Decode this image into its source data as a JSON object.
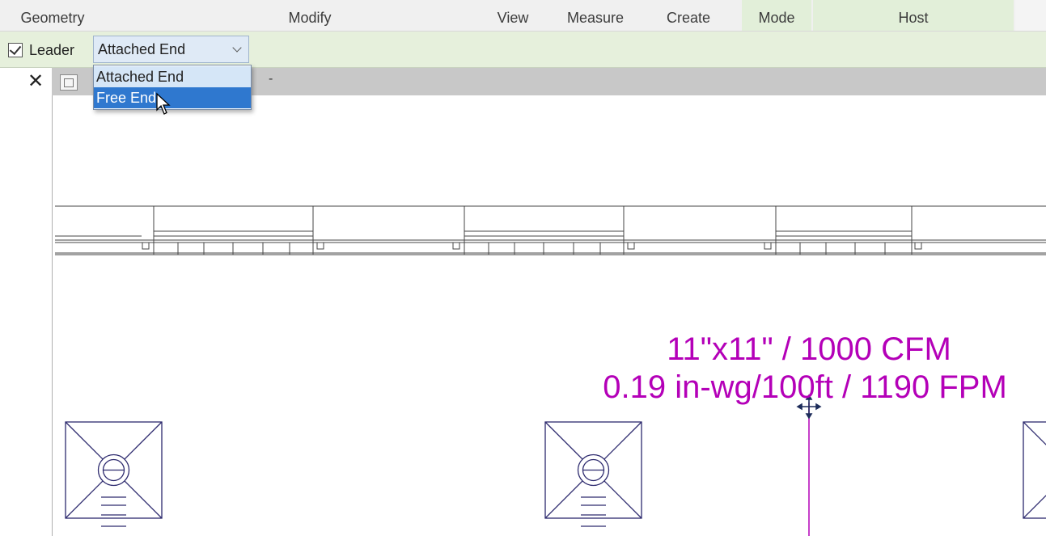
{
  "ribbon": {
    "panels": [
      "Geometry",
      "Modify",
      "View",
      "Measure",
      "Create",
      "Mode",
      "Host"
    ]
  },
  "options_bar": {
    "leader_label": "Leader",
    "leader_checked": true,
    "leader_mode_value": "Attached End",
    "dropdown_options": [
      "Attached End",
      "Free End"
    ],
    "highlighted_option": "Free End"
  },
  "view_tab": {
    "close_glyph": "✕",
    "separator": "-"
  },
  "tag": {
    "line1": "11\"x11\" / 1000 CFM",
    "line2": "0.19 in-wg/100ft / 1190 FPM",
    "color": "#b400b8"
  },
  "colors": {
    "linework": "#333366",
    "tag": "#b400b8",
    "selection": "#2f78cf"
  }
}
